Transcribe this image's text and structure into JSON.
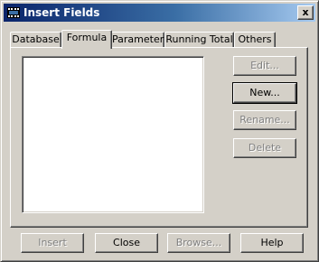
{
  "window": {
    "title": "Insert Fields",
    "close_label": "x"
  },
  "tabs": [
    {
      "label": "Database",
      "active": false
    },
    {
      "label": "Formula",
      "active": true
    },
    {
      "label": "Parameter",
      "active": false
    },
    {
      "label": "Running Total",
      "active": false
    },
    {
      "label": "Others",
      "active": false
    }
  ],
  "side_buttons": {
    "edit": {
      "label": "Edit...",
      "enabled": false
    },
    "new": {
      "label": "New...",
      "enabled": true
    },
    "rename": {
      "label": "Rename...",
      "enabled": false
    },
    "delete": {
      "label": "Delete",
      "enabled": false
    }
  },
  "bottom_buttons": {
    "insert": {
      "label": "Insert",
      "enabled": false
    },
    "close": {
      "label": "Close",
      "enabled": true
    },
    "browse": {
      "label": "Browse...",
      "enabled": false
    },
    "help": {
      "label": "Help",
      "enabled": true
    }
  },
  "formula_list": {
    "items": []
  }
}
